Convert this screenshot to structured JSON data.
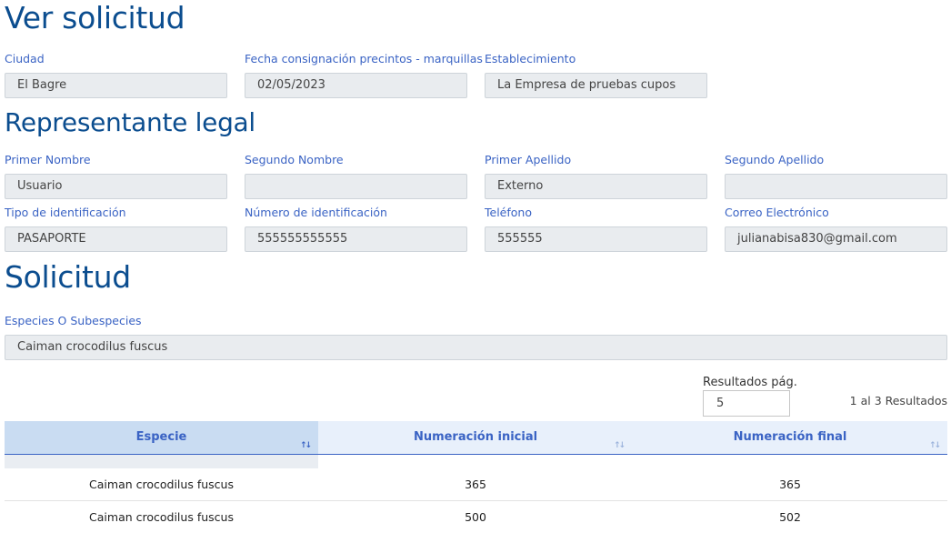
{
  "section_titles": {
    "ver_solicitud": "Ver solicitud",
    "representante": "Representante legal",
    "solicitud": "Solicitud"
  },
  "general": {
    "ciudad": {
      "label": "Ciudad",
      "value": "El Bagre"
    },
    "fecha": {
      "label": "Fecha consignación precintos - marquillas",
      "value": "02/05/2023"
    },
    "establecimiento": {
      "label": "Establecimiento",
      "value": "La Empresa de pruebas cupos"
    }
  },
  "representante": {
    "primer_nombre": {
      "label": "Primer Nombre",
      "value": "Usuario"
    },
    "segundo_nombre": {
      "label": "Segundo Nombre",
      "value": ""
    },
    "primer_apellido": {
      "label": "Primer Apellido",
      "value": "Externo"
    },
    "segundo_apellido": {
      "label": "Segundo Apellido",
      "value": ""
    },
    "tipo_id": {
      "label": "Tipo de identificación",
      "value": "PASAPORTE"
    },
    "numero_id": {
      "label": "Número de identificación",
      "value": "555555555555"
    },
    "telefono": {
      "label": "Teléfono",
      "value": "555555"
    },
    "correo": {
      "label": "Correo Electrónico",
      "value": "julianabisa830@gmail.com"
    }
  },
  "solicitud": {
    "especies": {
      "label": "Especies O Subespecies",
      "value": "Caiman crocodilus fuscus"
    }
  },
  "pagination": {
    "label": "Resultados pág.",
    "value": "5",
    "summary": "1 al 3 Resultados"
  },
  "table": {
    "columns": [
      "Especie",
      "Numeración inicial",
      "Numeración final"
    ],
    "rows": [
      [
        "Caiman crocodilus fuscus",
        "365",
        "365"
      ],
      [
        "Caiman crocodilus fuscus",
        "500",
        "502"
      ]
    ]
  },
  "colors": {
    "title": "#0b4d8f",
    "label": "#3a63c4",
    "field_bg": "#e9ecef",
    "header_bg": "#e8f0fb"
  },
  "icons": {
    "sort": "sort-arrows-icon"
  }
}
